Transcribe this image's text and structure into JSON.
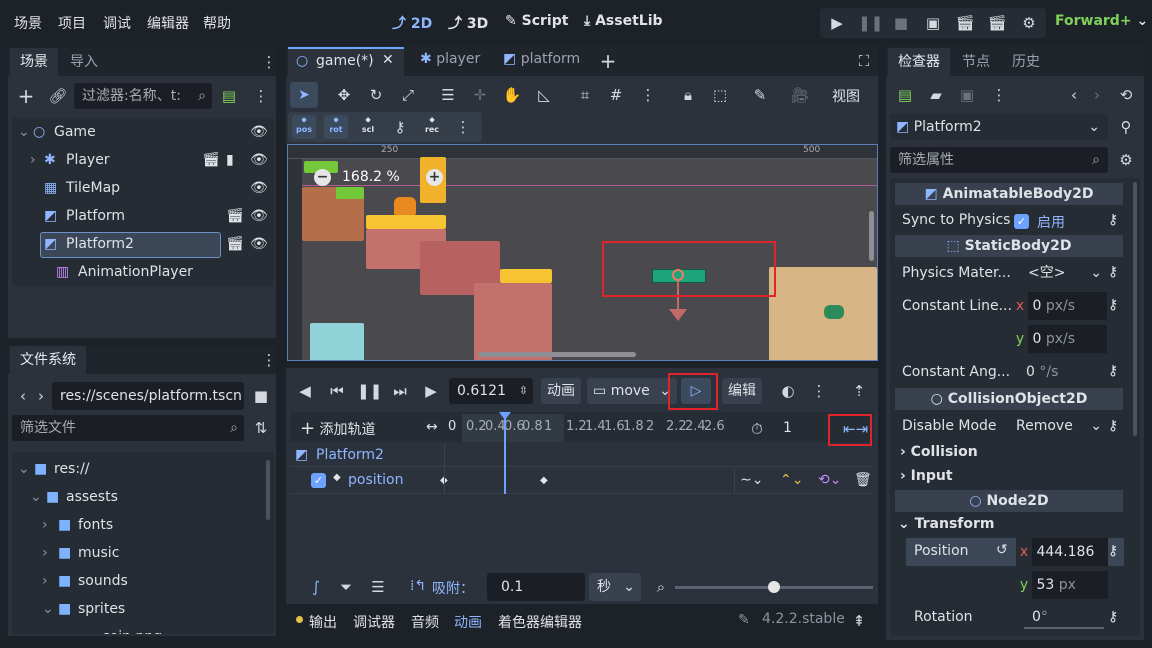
{
  "menu": [
    "场景",
    "项目",
    "调试",
    "编辑器",
    "帮助"
  ],
  "workspaces": [
    {
      "icon": "2d-icon",
      "label": "2D"
    },
    {
      "icon": "3d-icon",
      "label": "3D"
    },
    {
      "icon": "script-icon",
      "label": "Script"
    },
    {
      "icon": "assetlib-icon",
      "label": "AssetLib"
    }
  ],
  "renderer": "Forward+",
  "scene_dock": {
    "tabs": [
      "场景",
      "导入"
    ],
    "filter_placeholder": "过滤器:名称、t:",
    "tree": [
      {
        "name": "Game"
      },
      {
        "name": "Player"
      },
      {
        "name": "TileMap"
      },
      {
        "name": "Platform"
      },
      {
        "name": "Platform2"
      },
      {
        "name": "AnimationPlayer"
      }
    ]
  },
  "fs_dock": {
    "title": "文件系统",
    "path": "res://scenes/platform.tscn",
    "filter_placeholder": "筛选文件",
    "tree": [
      "res://",
      "assests",
      "fonts",
      "music",
      "sounds",
      "sprites",
      "coin.png"
    ]
  },
  "editor_tabs": [
    "game(*)",
    "player",
    "platform"
  ],
  "toolbar": {
    "view_label": "视图",
    "pos": "pos",
    "rot": "rot",
    "scl": "scl",
    "rec": "rec"
  },
  "viewport": {
    "zoom": "168.2 %",
    "ruler": [
      "250",
      "500"
    ]
  },
  "anim": {
    "time": "0.6121",
    "anim_label": "动画",
    "anim_name": "move",
    "edit_label": "编辑",
    "add_track": "添加轨道",
    "timeline": [
      "0",
      "0.2",
      "0.4",
      "0.6",
      "0.8",
      "1",
      "1.2",
      "1.4",
      "1.6",
      "1.8",
      "2",
      "2.2",
      "2.4",
      "2.6"
    ],
    "length": "1",
    "track_node": "Platform2",
    "track_prop": "position",
    "snap_label": "吸附：",
    "snap_value": "0.1",
    "snap_unit": "秒"
  },
  "bottom_tabs": [
    "输出",
    "调试器",
    "音频",
    "动画",
    "着色器编辑器"
  ],
  "version": "4.2.2.stable",
  "inspector": {
    "tabs": [
      "检查器",
      "节点",
      "历史"
    ],
    "object": "Platform2",
    "filter_placeholder": "筛选属性",
    "sections": {
      "animatable": "AnimatableBody2D",
      "static": "StaticBody2D",
      "collision": "CollisionObject2D",
      "node2d": "Node2D"
    },
    "sync_label": "Sync to Physics",
    "sync_value": "启用",
    "sync_checked": true,
    "phys_label": "Physics Mater...",
    "phys_value": "<空>",
    "const_lin_label": "Constant Line...",
    "cl_x": "0",
    "cl_y": "0",
    "cl_unit": "px/s",
    "const_ang_label": "Constant Ang...",
    "ca_value": "0",
    "ca_unit": "°/s",
    "disable_label": "Disable Mode",
    "disable_value": "Remove",
    "collision": "Collision",
    "input": "Input",
    "transform": "Transform",
    "pos_label": "Position",
    "pos_x": "444.186",
    "pos_y": "53",
    "pos_unit": "px",
    "rot_label": "Rotation",
    "rot_value": "0",
    "rot_unit": "°"
  },
  "colors": {
    "accent": "#6fa2ff",
    "bg": "#1d2229",
    "panel": "#2b323b",
    "highlight": "#e0242c"
  }
}
